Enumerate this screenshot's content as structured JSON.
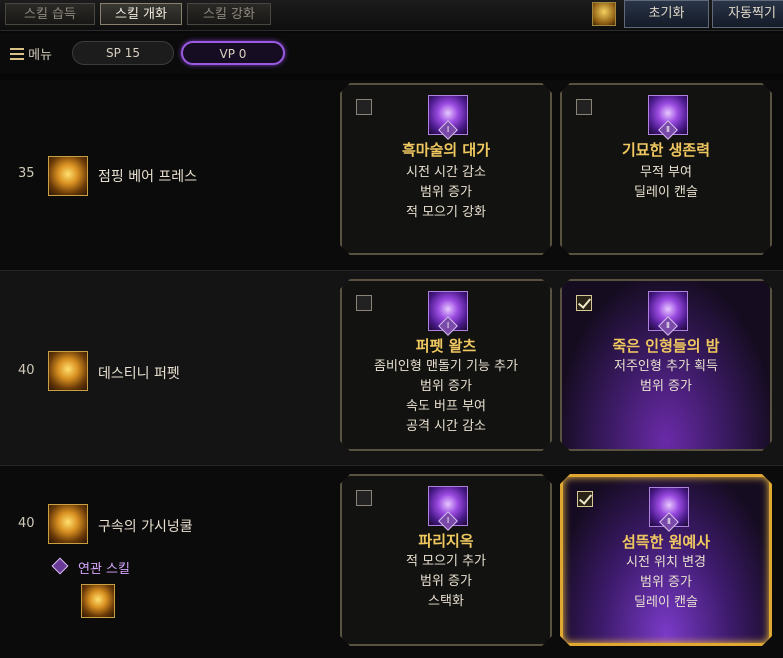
{
  "tabs": [
    {
      "label": "스킬 습득"
    },
    {
      "label": "스킬 개화"
    },
    {
      "label": "스킬 강화"
    }
  ],
  "top_buttons": {
    "reset": "초기화",
    "auto": "자동찍기"
  },
  "menu": {
    "label": "메뉴"
  },
  "points": {
    "sp": "SP 15",
    "vp": "VP 0"
  },
  "skills": [
    {
      "level": "35",
      "name": "점핑 베어 프레스",
      "icon": "jumping-bear-press-icon",
      "options": [
        {
          "tier": "Ⅰ",
          "title": "흑마술의 대가",
          "desc": [
            "시전 시간 감소",
            "범위 증가",
            "적 모으기 강화"
          ],
          "checked": false,
          "icon": "dark-magic-master-icon"
        },
        {
          "tier": "Ⅱ",
          "title": "기묘한 생존력",
          "desc": [
            "무적 부여",
            "딜레이 캔슬"
          ],
          "checked": false,
          "icon": "strange-vitality-icon"
        }
      ]
    },
    {
      "level": "40",
      "name": "데스티니 퍼펫",
      "icon": "destiny-puppet-icon",
      "options": [
        {
          "tier": "Ⅰ",
          "title": "퍼펫 왈츠",
          "desc": [
            "좀비인형 맨돌기 기능 추가",
            "범위 증가",
            "속도 버프 부여",
            "공격 시간 감소"
          ],
          "checked": false,
          "icon": "puppet-waltz-icon"
        },
        {
          "tier": "Ⅱ",
          "title": "죽은 인형들의 밤",
          "desc": [
            "저주인형 추가 획득",
            "범위 증가"
          ],
          "checked": true,
          "icon": "night-of-dead-dolls-icon"
        }
      ]
    },
    {
      "level": "40",
      "name": "구속의 가시넝쿨",
      "icon": "binding-thorn-vine-icon",
      "related_label": "연관 스킬",
      "options": [
        {
          "tier": "Ⅰ",
          "title": "파리지옥",
          "desc": [
            "적 모으기 추가",
            "범위 증가",
            "스택화"
          ],
          "checked": false,
          "icon": "flytrap-icon"
        },
        {
          "tier": "Ⅱ",
          "title": "섬뜩한 원예사",
          "desc": [
            "시전 위치 변경",
            "범위 증가",
            "딜레이 캔슬"
          ],
          "checked": true,
          "icon": "eerie-gardener-icon"
        }
      ]
    }
  ],
  "colors": {
    "accent_gold": "#f0c860",
    "vp_purple": "#9a5ae0",
    "selected_border": "#e0a830"
  }
}
